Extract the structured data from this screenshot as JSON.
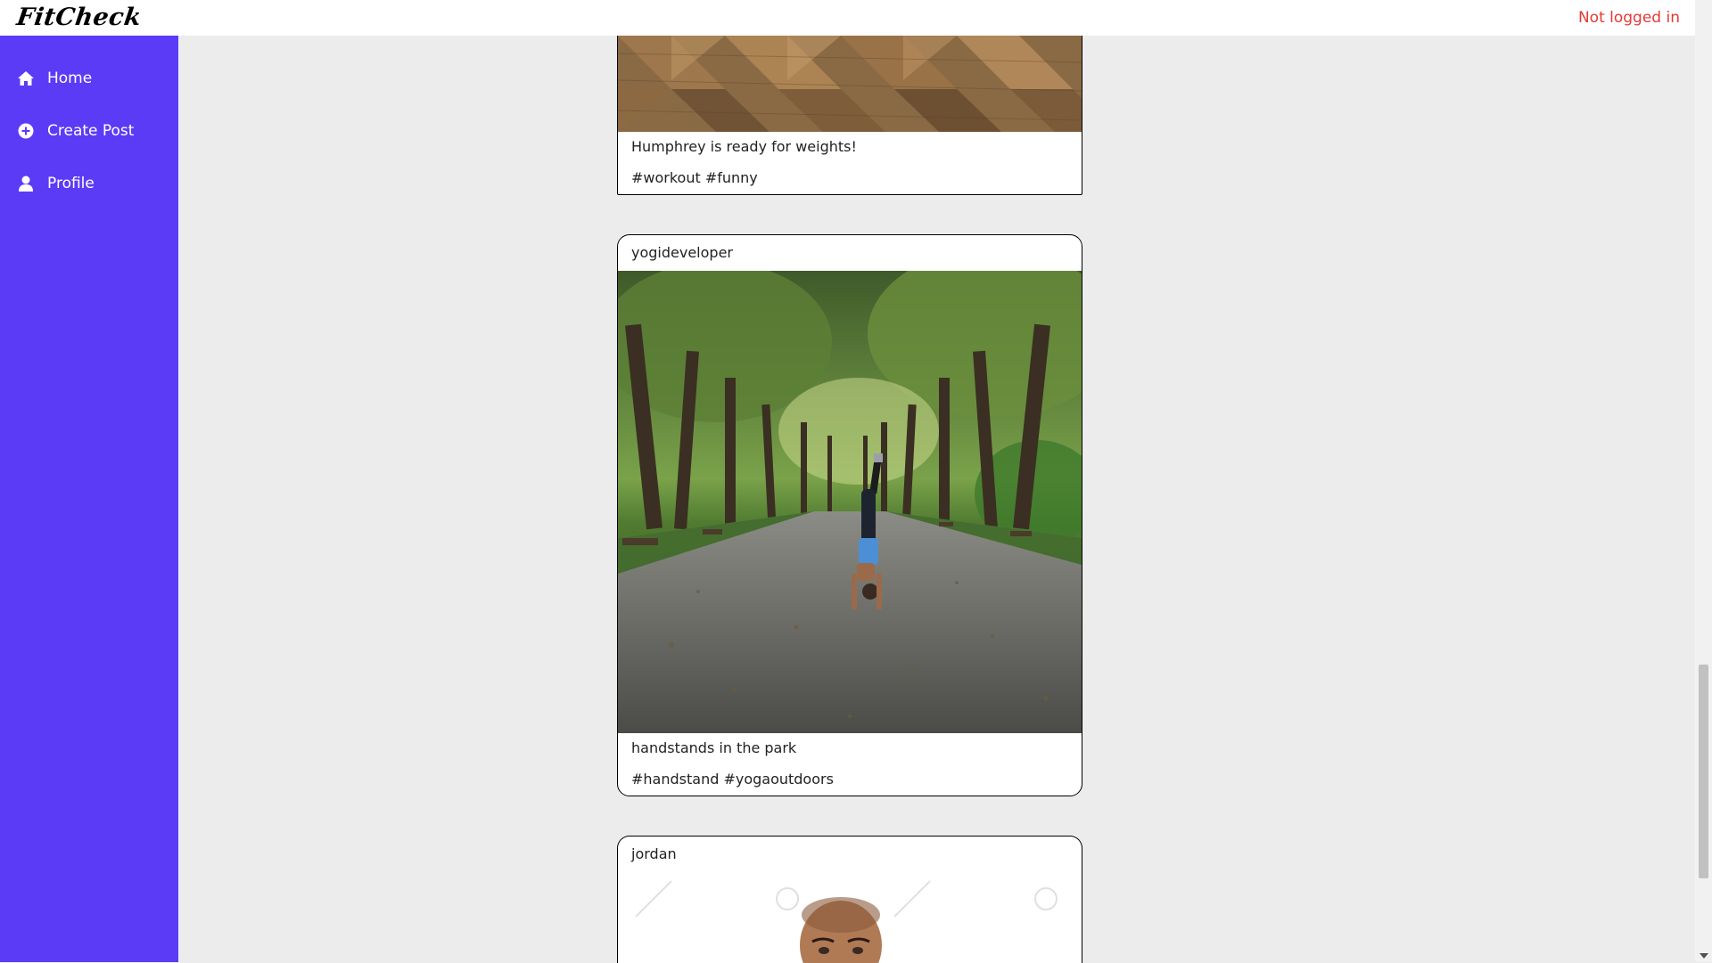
{
  "header": {
    "logo_text": "FitCheck",
    "login_status": "Not logged in",
    "login_status_color": "#e53935"
  },
  "sidebar": {
    "background": "#5b3bf5",
    "items": [
      {
        "label": "Home",
        "icon": "home-icon"
      },
      {
        "label": "Create Post",
        "icon": "plus-circle-icon"
      },
      {
        "label": "Profile",
        "icon": "user-icon"
      }
    ]
  },
  "feed": {
    "posts": [
      {
        "username": "",
        "image": "parquet-floor-photo",
        "caption": "Humphrey is ready for weights!",
        "tags": "#workout #funny"
      },
      {
        "username": "yogideveloper",
        "image": "park-handstand-photo",
        "caption": "handstands in the park",
        "tags": "#handstand #yogaoutdoors"
      },
      {
        "username": "jordan",
        "image": "headshot-photo",
        "caption": "",
        "tags": ""
      }
    ]
  }
}
